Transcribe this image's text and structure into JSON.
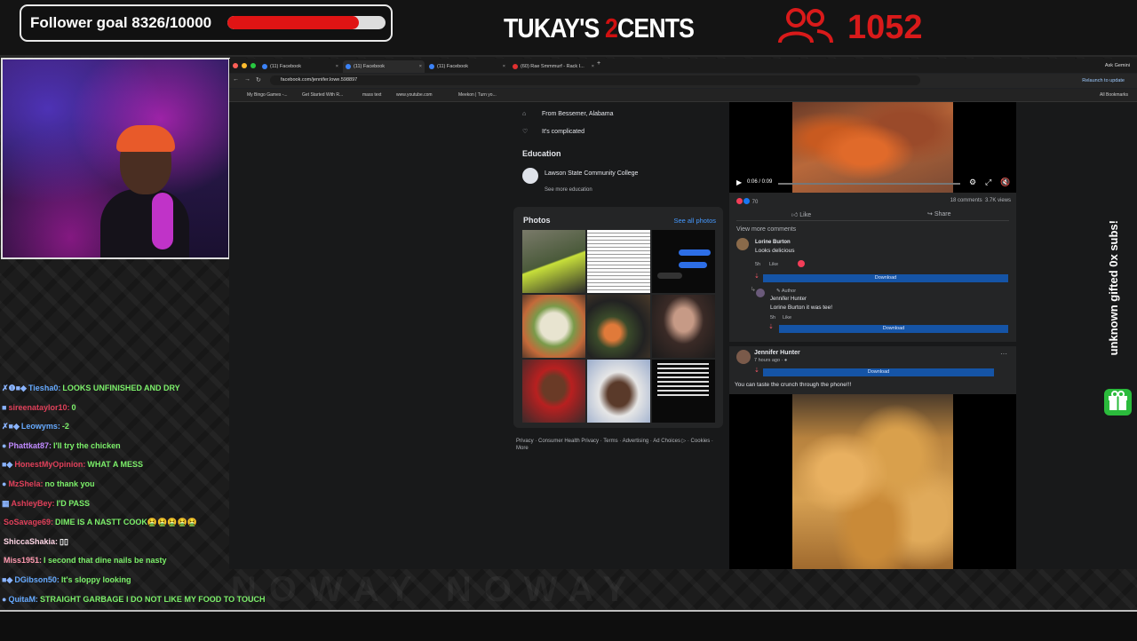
{
  "overlay": {
    "goal_text": "Follower goal 8326/10000",
    "goal_progress": 0.8326,
    "logo_part1": "TUKAY'S ",
    "logo_part2": "2",
    "logo_part3": "CENTS",
    "viewer_count": "1052",
    "gifted_text": "unknown gifted 0x subs!",
    "accent_red": "#e01414"
  },
  "chat": [
    {
      "badges": "✗❶■◆",
      "user": "Tiesha0:",
      "user_color": "#66aaff",
      "msg": "LOOKS UNFINISHED AND DRY",
      "msg_color": "#7cf06a"
    },
    {
      "badges": "■",
      "user": "sireenataylor10:",
      "user_color": "#e0405a",
      "msg": "0",
      "msg_color": "#7cf06a"
    },
    {
      "badges": "✗■◆",
      "user": "Leowyms:",
      "user_color": "#66aaff",
      "msg": "-2",
      "msg_color": "#7cf06a"
    },
    {
      "badges": "●",
      "user": "Phattkat87:",
      "user_color": "#c08aff",
      "msg": "I'll try the chicken",
      "msg_color": "#7cf06a"
    },
    {
      "badges": "■◆",
      "user": "HonestMyOpinion:",
      "user_color": "#e0405a",
      "msg": "WHAT A MESS",
      "msg_color": "#7cf06a"
    },
    {
      "badges": "●",
      "user": "MzShela:",
      "user_color": "#e0405a",
      "msg": "no thank you",
      "msg_color": "#7cf06a"
    },
    {
      "badges": "▦",
      "user": "AshleyBey:",
      "user_color": "#e0405a",
      "msg": "I'D PASS",
      "msg_color": "#7cf06a"
    },
    {
      "badges": "",
      "user": "SoSavage69:",
      "user_color": "#e0405a",
      "msg": "DIME IS A NASTT COOK🤮🤮🤮🤮🤮",
      "msg_color": "#7cf06a"
    },
    {
      "badges": "",
      "user": "ShiccaShakia:",
      "user_color": "#ffd6e6",
      "msg": "▯▯",
      "msg_color": "#ffffff"
    },
    {
      "badges": "",
      "user": "Miss1951:",
      "user_color": "#ff9ab0",
      "msg": "I second that dine nails be nasty",
      "msg_color": "#7cf06a"
    },
    {
      "badges": "■◆",
      "user": "DGibson50:",
      "user_color": "#66aaff",
      "msg": "It's sloppy looking",
      "msg_color": "#7cf06a"
    },
    {
      "badges": "●",
      "user": "QuitaM:",
      "user_color": "#66aaff",
      "msg": "STRAIGHT GARBAGE I DO NOT LIKE MY FOOD TO TOUCH",
      "msg_color": "#7cf06a"
    }
  ],
  "browser": {
    "tabs": [
      {
        "label": "(11) Facebook"
      },
      {
        "label": "(11) Facebook"
      },
      {
        "label": "(11) Facebook"
      },
      {
        "label": "(60) Rae Smmmurf - Rack I..."
      }
    ],
    "ask_gemini": "Ask Gemini",
    "url": "facebook.com/jennifer.lowe.598897",
    "relaunch": "Relaunch to update",
    "bookmarks": [
      "My Bingo Games -...",
      "Get Started With R...",
      "mass text",
      "www.youtube.com",
      "",
      "Meekon | Turn yo..."
    ],
    "all_bookmarks": "All Bookmarks"
  },
  "profile": {
    "from": "From Bessemer, Alabama",
    "relationship": "It's complicated",
    "education_title": "Education",
    "school": "Lawson State Community College",
    "see_more_education": "See more education",
    "photos_title": "Photos",
    "see_all_photos": "See all photos",
    "footer": "Privacy · Consumer Health Privacy · Terms · Advertising · Ad Choices ▷ · Cookies · More"
  },
  "feed": {
    "video_time": "0:06 / 0:09",
    "reaction_count": "70",
    "comments_count": "18 comments",
    "views_count": "3.7K views",
    "like_label": "Like",
    "share_label": "Share",
    "view_more_comments": "View more comments",
    "comment1": {
      "name": "Lorine Burton",
      "text": "Looks delicious",
      "time": "5h",
      "like": "Like"
    },
    "download_label": "Download",
    "comment2": {
      "badge": "Author",
      "name": "Jennifer Hunter",
      "text": "Lorine Burton it was tee!",
      "time": "5h",
      "like": "Like"
    },
    "post": {
      "name": "Jennifer Hunter",
      "time": "7 hours ago · ●",
      "text": "You can taste the crunch through the phone!!!",
      "more": "···"
    }
  }
}
